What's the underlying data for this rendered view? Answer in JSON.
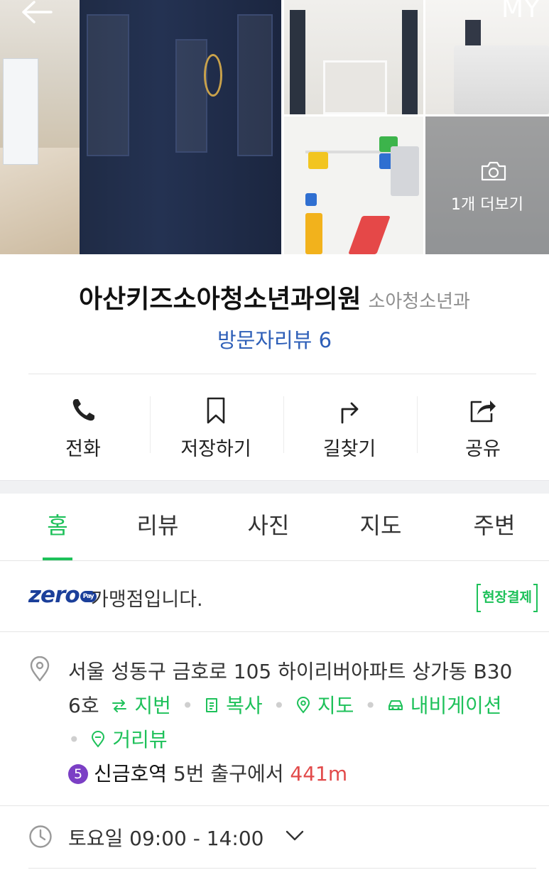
{
  "header": {
    "back_icon": "arrow-left-icon",
    "my_label": "MY"
  },
  "gallery": {
    "more_label": "1개 더보기",
    "camera_icon": "camera-icon"
  },
  "place": {
    "name": "아산키즈소아청소년과의원",
    "category": "소아청소년과",
    "review_link": "방문자리뷰 6"
  },
  "actions": [
    {
      "label": "전화",
      "icon": "phone-icon"
    },
    {
      "label": "저장하기",
      "icon": "bookmark-icon"
    },
    {
      "label": "길찾기",
      "icon": "directions-icon"
    },
    {
      "label": "공유",
      "icon": "share-icon"
    }
  ],
  "tabs": [
    {
      "label": "홈",
      "active": true
    },
    {
      "label": "리뷰",
      "active": false
    },
    {
      "label": "사진",
      "active": false
    },
    {
      "label": "지도",
      "active": false
    },
    {
      "label": "주변",
      "active": false
    }
  ],
  "zeropay": {
    "logo_text": "zero",
    "logo_pay": "Pay",
    "text": "가맹점입니다.",
    "badge": "현장결제"
  },
  "address": {
    "line1": "서울 성동구 금호로 105 하이리버아파트 상가동 B30",
    "line2_prefix": "6호",
    "links": {
      "jibun": "지번",
      "copy": "복사",
      "map": "지도",
      "navigation": "내비게이션",
      "street_view": "거리뷰"
    },
    "subway": {
      "line_number": "5",
      "station": "신금호역",
      "exit_text": "5번 출구에서",
      "distance": "441m"
    }
  },
  "hours": {
    "text": "토요일 09:00 - 14:00"
  },
  "colors": {
    "accent_green": "#1ec15a",
    "link_blue": "#2e5fb8",
    "distance_red": "#e24b4b",
    "subway_line5": "#7b3fc5",
    "zeropay_blue": "#1b3f9a"
  }
}
